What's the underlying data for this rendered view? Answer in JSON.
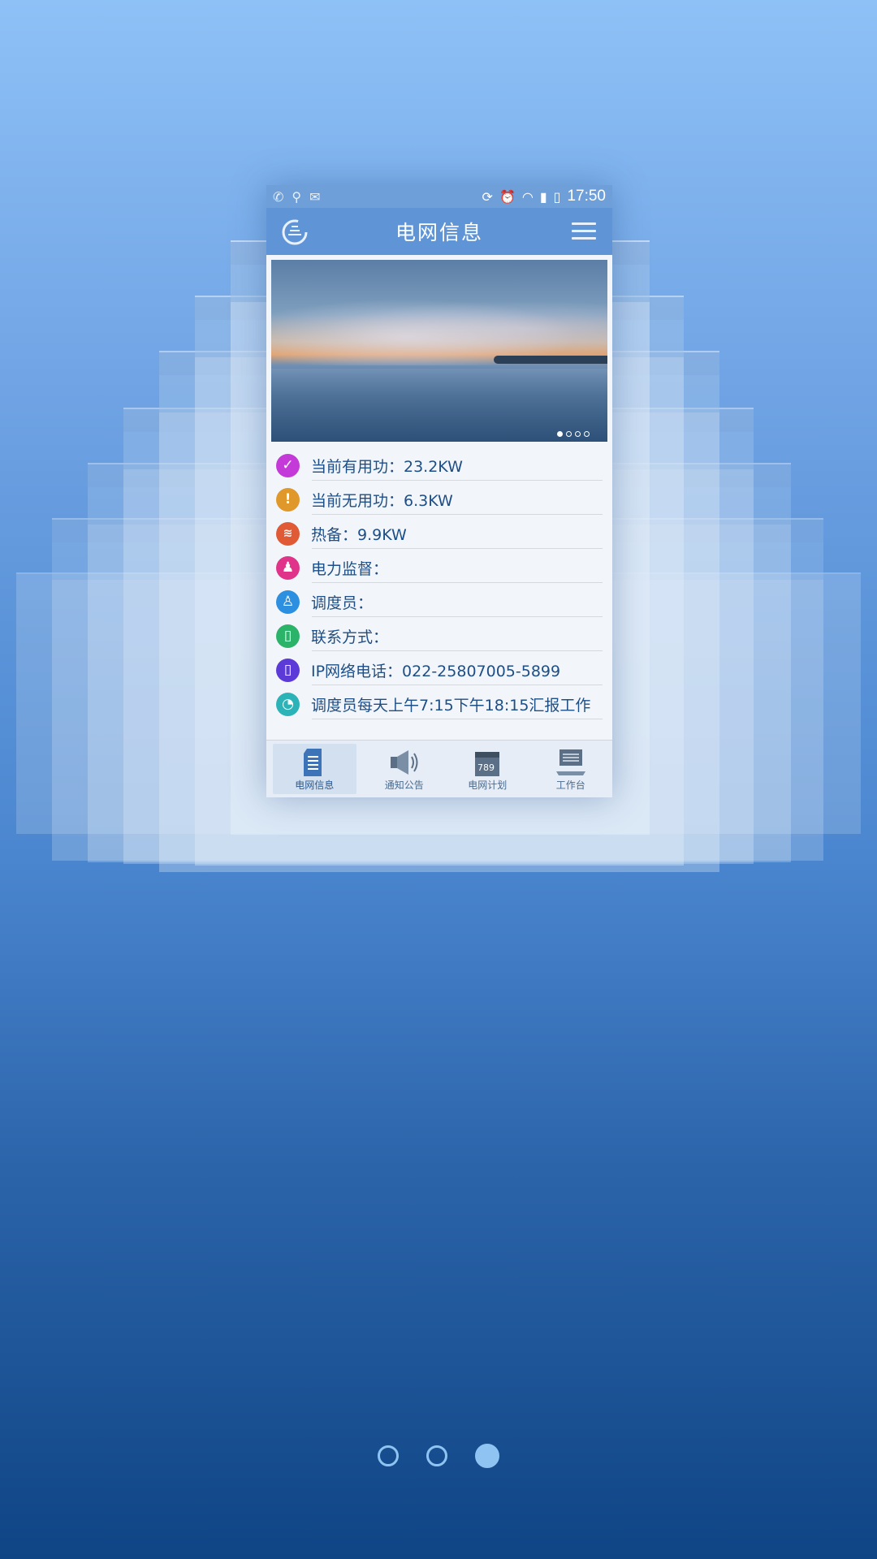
{
  "status_bar": {
    "time": "17:50"
  },
  "app_bar": {
    "title": "电网信息"
  },
  "banner": {
    "slide_count": 4,
    "active_slide": 1
  },
  "info_rows": [
    {
      "icon": "check-icon",
      "color": "#c43ad8",
      "text": "当前有用功：23.2KW"
    },
    {
      "icon": "exclamation-icon",
      "color": "#e0982a",
      "text": "当前无用功：6.3KW"
    },
    {
      "icon": "heat-icon",
      "color": "#e05a36",
      "text": "热备：9.9KW"
    },
    {
      "icon": "supervisor-icon",
      "color": "#e0348a",
      "text": "电力监督："
    },
    {
      "icon": "dispatcher-icon",
      "color": "#2c8fe0",
      "text": "调度员："
    },
    {
      "icon": "phone-icon",
      "color": "#2cb36a",
      "text": "联系方式："
    },
    {
      "icon": "mobile-icon",
      "color": "#5b3ad8",
      "text": "IP网络电话：022-25807005-5899"
    },
    {
      "icon": "clock-icon",
      "color": "#2bb3b8",
      "text": "调度员每天上午7:15下午18:15汇报工作"
    }
  ],
  "tabs": [
    {
      "label": "电网信息",
      "icon": "document-icon",
      "active": true
    },
    {
      "label": "通知公告",
      "icon": "speaker-icon",
      "active": false
    },
    {
      "label": "电网计划",
      "icon": "calendar-icon",
      "active": false
    },
    {
      "label": "工作台",
      "icon": "workstation-icon",
      "active": false
    }
  ],
  "pager": {
    "count": 3,
    "active": 3
  },
  "colors": {
    "accent": "#5f95d6",
    "text": "#1e4e86",
    "pager": "#8fc4f2"
  }
}
